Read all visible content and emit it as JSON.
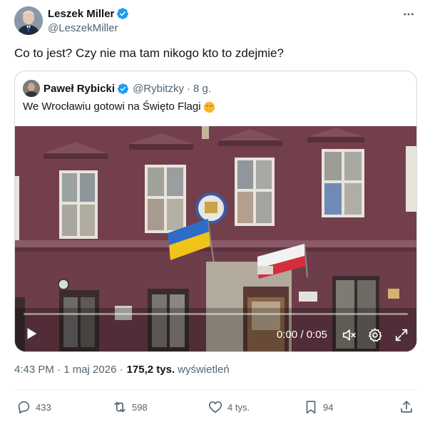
{
  "author": {
    "name": "Leszek Miller",
    "handle": "@LeszekMiller",
    "verified": true
  },
  "tweet": {
    "text": "Co to jest? Czy nie ma tam nikogo kto to zdejmie?"
  },
  "quote": {
    "name": "Paweł Rybicki",
    "handle": "@Rybitzky",
    "separator": "·",
    "time": "8 g.",
    "text": "We Wrocławiu gotowi na Święto Flagi",
    "emoji": "shushing-face-emoji"
  },
  "video": {
    "time_readout": "0:00 / 0:05",
    "progress": 0.0
  },
  "meta": {
    "timestamp": "4:43 PM · 1 maj 2026 ·",
    "views_count": "175,2 tys.",
    "views_label": "wyświetleń"
  },
  "actions": {
    "replies": "433",
    "reposts": "598",
    "likes": "4 tys.",
    "bookmarks": "94"
  },
  "colors": {
    "verified": "#1d9bf0",
    "text": "#0f1419",
    "secondary": "#536471",
    "border": "#cfd9de",
    "building": "#6b3a48"
  },
  "icons": [
    "verified-badge-icon",
    "more-icon",
    "play-icon",
    "volume-icon",
    "gear-icon",
    "expand-icon",
    "reply-icon",
    "repost-icon",
    "like-icon",
    "bookmark-icon",
    "share-icon"
  ]
}
